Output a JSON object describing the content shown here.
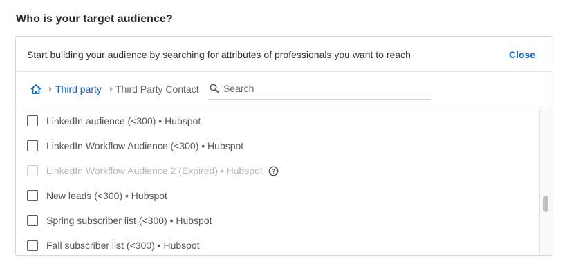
{
  "heading": "Who is your target audience?",
  "panel": {
    "intro": "Start building your audience by searching for attributes of professionals you want to reach",
    "close_label": "Close"
  },
  "breadcrumb": {
    "home_icon": "home-icon",
    "items": [
      {
        "label": "Third party",
        "link": true
      },
      {
        "label": "Third Party Contact",
        "link": false
      }
    ]
  },
  "search": {
    "placeholder": "Search",
    "value": ""
  },
  "list": {
    "items": [
      {
        "label": "LinkedIn audience (<300) • Hubspot",
        "checked": false,
        "disabled": false
      },
      {
        "label": "LinkedIn Workflow Audience (<300) • Hubspot",
        "checked": false,
        "disabled": false
      },
      {
        "label": "LinkedIn Workflow Audience 2 (Expired) • Hubspot",
        "checked": false,
        "disabled": true,
        "help_icon": "help-circle-icon"
      },
      {
        "label": "New leads (<300) • Hubspot",
        "checked": false,
        "disabled": false
      },
      {
        "label": "Spring subscriber list (<300) • Hubspot",
        "checked": false,
        "disabled": false
      },
      {
        "label": "Fall subscriber list (<300) • Hubspot",
        "checked": false,
        "disabled": false
      }
    ]
  },
  "colors": {
    "link": "#0a66c2",
    "text": "#333333",
    "disabled": "#b7b7b7"
  }
}
